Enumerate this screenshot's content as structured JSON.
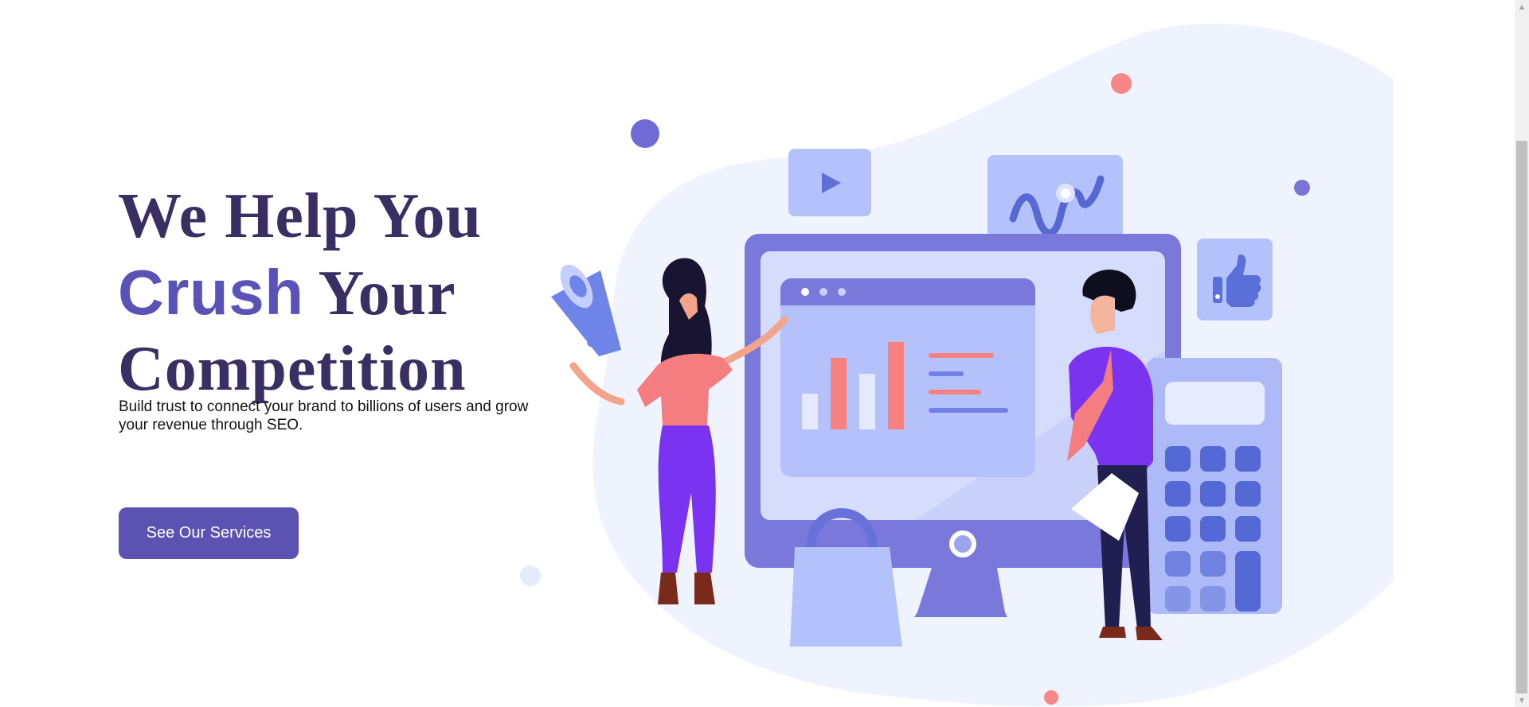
{
  "hero": {
    "headline_line1": "We Help You",
    "headline_accent": "Crush",
    "headline_line2_rest": " Your",
    "headline_line3": "Competition",
    "subtext": "Build trust to connect your brand to billions of users and grow your revenue through SEO.",
    "cta_label": "See Our Services"
  },
  "illustration": {
    "icons": [
      "megaphone-icon",
      "play-icon",
      "analytics-wave-icon",
      "thumbs-up-icon",
      "shopping-bag-icon",
      "calculator-icon"
    ]
  },
  "colors": {
    "headline": "#3a2f62",
    "accent": "#5b52b8",
    "button": "#5b52b1",
    "blob": "#eef3fe",
    "monitor": "#7b78db",
    "coral": "#f7817f"
  },
  "scrollbar": {
    "up_arrow": "▲",
    "down_arrow": "▼"
  }
}
